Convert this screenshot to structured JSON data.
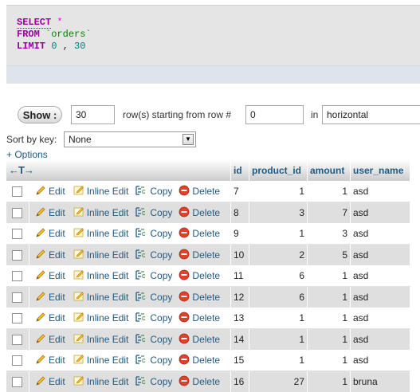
{
  "sql": {
    "select": "SELECT",
    "star": "*",
    "from": "FROM",
    "table": "`orders`",
    "limit": "LIMIT",
    "offset": "0",
    "comma": ",",
    "count": "30"
  },
  "nav": {
    "show_label": "Show :",
    "rows_value": "30",
    "rows_text": "row(s) starting from row #",
    "start_value": "0",
    "in_text": "in",
    "mode_value": "horizontal",
    "sort_label": "Sort by key:",
    "sort_value": "None",
    "options_link": "+ Options"
  },
  "table": {
    "arrows": "←T→",
    "columns": [
      "id",
      "product_id",
      "amount",
      "user_name"
    ],
    "actions": {
      "edit": "Edit",
      "inline_edit": "Inline Edit",
      "copy": "Copy",
      "delete": "Delete"
    },
    "rows": [
      {
        "id": "7",
        "product_id": "1",
        "amount": "1",
        "user_name": "asd"
      },
      {
        "id": "8",
        "product_id": "3",
        "amount": "7",
        "user_name": "asd"
      },
      {
        "id": "9",
        "product_id": "1",
        "amount": "3",
        "user_name": "asd"
      },
      {
        "id": "10",
        "product_id": "2",
        "amount": "5",
        "user_name": "asd"
      },
      {
        "id": "11",
        "product_id": "6",
        "amount": "1",
        "user_name": "asd"
      },
      {
        "id": "12",
        "product_id": "6",
        "amount": "1",
        "user_name": "asd"
      },
      {
        "id": "13",
        "product_id": "1",
        "amount": "1",
        "user_name": "asd"
      },
      {
        "id": "14",
        "product_id": "1",
        "amount": "1",
        "user_name": "asd"
      },
      {
        "id": "15",
        "product_id": "1",
        "amount": "1",
        "user_name": "asd"
      },
      {
        "id": "16",
        "product_id": "27",
        "amount": "1",
        "user_name": "bruna"
      }
    ]
  },
  "colors": {
    "link": "#235a81",
    "keyword": "#990099",
    "string": "#008000",
    "number": "#008080"
  },
  "icons": [
    "pencil-icon",
    "inline-edit-icon",
    "copy-icon",
    "delete-icon",
    "dropdown-arrow-icon"
  ]
}
